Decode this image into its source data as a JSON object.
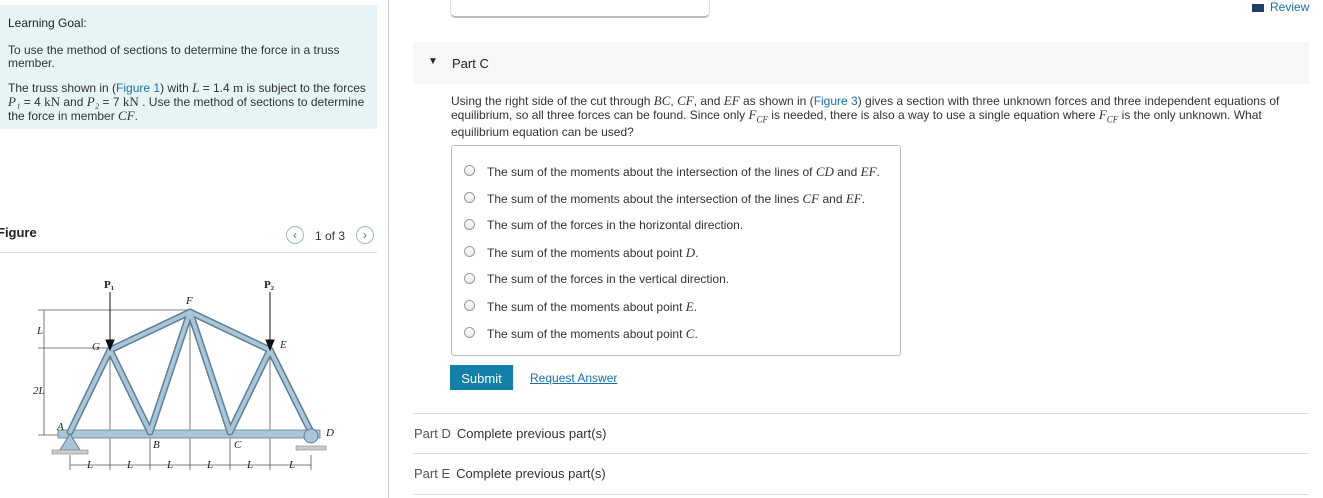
{
  "learning_goal": {
    "title": "Learning Goal:",
    "para1": "To use the method of sections to determine the force in a truss member.",
    "p2_a": "The truss shown in (",
    "p2_link": "Figure 1",
    "p2_b": ") with ",
    "p2_L": "L",
    "p2_c": " = 1.4 ",
    "p2_m": "m",
    "p2_d": " is subject to the forces ",
    "p2_P1": "P₁",
    "p2_e": " = 4 ",
    "p2_kN1": "kN",
    "p2_f": " and ",
    "p2_P2": "P₂",
    "p2_g": " = 7 ",
    "p2_kN2": "kN",
    "p2_h": " . Use the method of sections to determine the force in member ",
    "p2_CF": "CF",
    "p2_i": "."
  },
  "figure": {
    "label": "Figure",
    "pager": "1 of 3",
    "prev_icon": "chevron-left-icon",
    "next_icon": "chevron-right-icon",
    "labels": {
      "P1": "P₁",
      "P2": "P₂",
      "F": "F",
      "G": "G",
      "E": "E",
      "A": "A",
      "B": "B",
      "C": "C",
      "D": "D",
      "L": "L",
      "2L": "2L",
      "dim": "L"
    }
  },
  "header": {
    "review": "Review",
    "review_icon": "book-icon"
  },
  "part_c": {
    "title": "Part C",
    "q_a": "Using the right side of the cut through ",
    "q_BC": "BC",
    "q_comma1": ", ",
    "q_CF": "CF",
    "q_and": ", and ",
    "q_EF": "EF",
    "q_b": " as shown in (",
    "q_link": "Figure 3",
    "q_c": ") gives a section with three unknown forces and three independent equations of equilibrium, so all three forces can be found. Since only ",
    "q_F": "F",
    "q_sub": "CF",
    "q_d": " is needed, there is also a way to use a single equation where ",
    "q_F2": "F",
    "q_sub2": "CF",
    "q_e": " is the only unknown. What equilibrium equation can be used?",
    "options": [
      {
        "pre": "The sum of the moments about the intersection of the lines of ",
        "m1": "CD",
        "mid": " and ",
        "m2": "EF",
        "post": "."
      },
      {
        "pre": "The sum of the moments about the intersection of the lines ",
        "m1": "CF",
        "mid": " and ",
        "m2": "EF",
        "post": "."
      },
      {
        "pre": "The sum of the forces in the horizontal direction.",
        "m1": "",
        "mid": "",
        "m2": "",
        "post": ""
      },
      {
        "pre": "The sum of the moments about point ",
        "m1": "D",
        "mid": "",
        "m2": "",
        "post": "."
      },
      {
        "pre": "The sum of the forces in the vertical direction.",
        "m1": "",
        "mid": "",
        "m2": "",
        "post": ""
      },
      {
        "pre": "The sum of the moments about point ",
        "m1": "E",
        "mid": "",
        "m2": "",
        "post": "."
      },
      {
        "pre": "The sum of the moments about point ",
        "m1": "C",
        "mid": "",
        "m2": "",
        "post": "."
      }
    ],
    "submit": "Submit",
    "request_answer": "Request Answer"
  },
  "part_d": {
    "label": "Part D",
    "status": "Complete previous part(s)"
  },
  "part_e": {
    "label": "Part E",
    "status": "Complete previous part(s)"
  },
  "colors": {
    "accent": "#1480a8",
    "link": "#1a6fa8",
    "goal_bg": "#e6f4f5",
    "truss": "#8fb3c9"
  }
}
